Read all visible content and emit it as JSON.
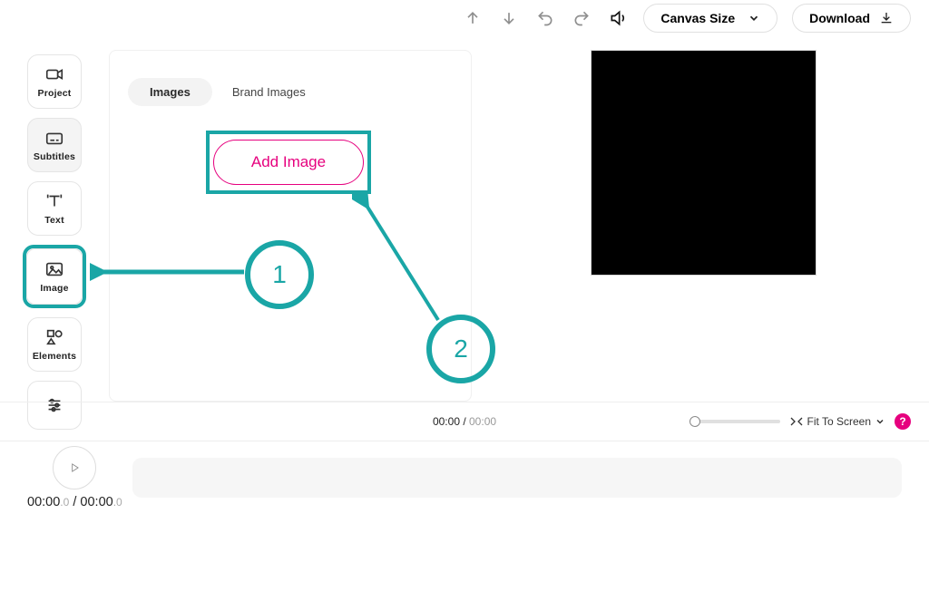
{
  "toolbar": {
    "canvas_size_label": "Canvas Size",
    "download_label": "Download"
  },
  "tools": {
    "project": "Project",
    "subtitles": "Subtitles",
    "text": "Text",
    "image": "Image",
    "elements": "Elements"
  },
  "panel": {
    "tab_images": "Images",
    "tab_brand": "Brand Images",
    "add_image": "Add Image"
  },
  "annotations": {
    "one": "1",
    "two": "2"
  },
  "timebar": {
    "current": "00:00",
    "sep": " / ",
    "duration": "00:00",
    "fit": "Fit To Screen",
    "help": "?"
  },
  "playtime": {
    "cur_main": "00:00",
    "cur_frac": ".0",
    "sep": " / ",
    "dur_main": "00:00",
    "dur_frac": ".0"
  }
}
